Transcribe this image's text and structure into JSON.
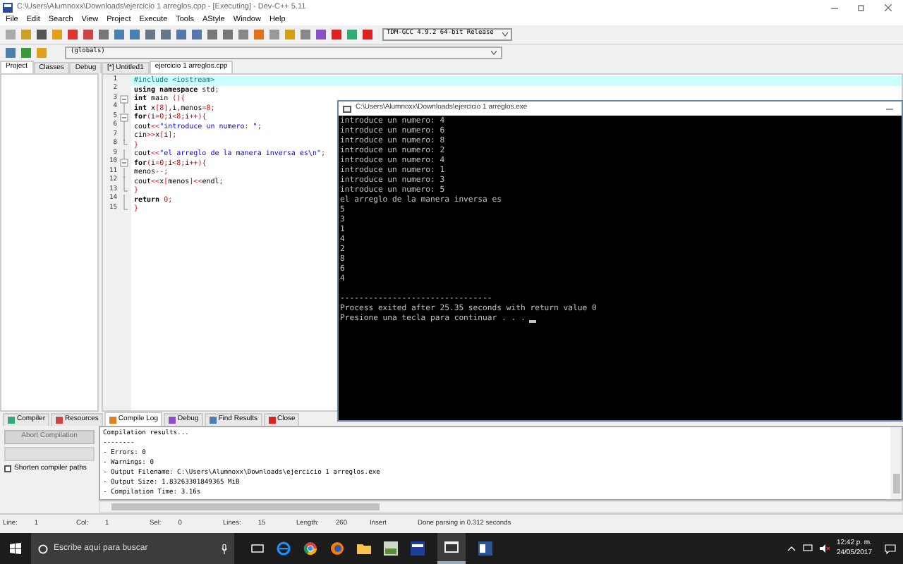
{
  "window": {
    "title": "C:\\Users\\Alumnoxx\\Downloads\\ejercicio 1 arreglos.cpp - [Executing] - Dev-C++ 5.11"
  },
  "menu": [
    "File",
    "Edit",
    "Search",
    "View",
    "Project",
    "Execute",
    "Tools",
    "AStyle",
    "Window",
    "Help"
  ],
  "compiler_select": {
    "value": "TDM-GCC 4.9.2 64-bit Release"
  },
  "scope_select": {
    "value": "(globals)"
  },
  "side_tabs": [
    {
      "label": "Project",
      "selected": true
    },
    {
      "label": "Classes",
      "selected": false
    },
    {
      "label": "Debug",
      "selected": false
    }
  ],
  "editor_tabs": [
    {
      "label": "[*] Untitled1",
      "selected": false
    },
    {
      "label": "ejercicio 1 arreglos.cpp",
      "selected": true
    }
  ],
  "code": [
    {
      "number": "1",
      "kind": "plain",
      "current": true,
      "tokens": [
        {
          "kind": "pre",
          "text": "#include <iostream>"
        }
      ]
    },
    {
      "number": "2",
      "kind": "plain",
      "current": false,
      "tokens": [
        {
          "kind": "kw",
          "text": "using namespace"
        },
        {
          "kind": "txt",
          "text": " std"
        },
        {
          "kind": "sym",
          "text": ";"
        }
      ]
    },
    {
      "number": "3",
      "kind": "open",
      "current": false,
      "tokens": [
        {
          "kind": "kw",
          "text": "int"
        },
        {
          "kind": "txt",
          "text": " main "
        },
        {
          "kind": "sym",
          "text": "(){"
        }
      ]
    },
    {
      "number": "4",
      "kind": "body",
      "current": false,
      "tokens": [
        {
          "kind": "kw",
          "text": "int"
        },
        {
          "kind": "txt",
          "text": " x"
        },
        {
          "kind": "sym",
          "text": "["
        },
        {
          "kind": "num",
          "text": "8"
        },
        {
          "kind": "sym",
          "text": "],"
        },
        {
          "kind": "txt",
          "text": "i"
        },
        {
          "kind": "sym",
          "text": ","
        },
        {
          "kind": "txt",
          "text": "menos"
        },
        {
          "kind": "sym",
          "text": "="
        },
        {
          "kind": "num",
          "text": "8"
        },
        {
          "kind": "sym",
          "text": ";"
        }
      ]
    },
    {
      "number": "5",
      "kind": "open",
      "current": false,
      "tokens": [
        {
          "kind": "kw",
          "text": "for"
        },
        {
          "kind": "sym",
          "text": "("
        },
        {
          "kind": "txt",
          "text": "i"
        },
        {
          "kind": "sym",
          "text": "="
        },
        {
          "kind": "num",
          "text": "0"
        },
        {
          "kind": "sym",
          "text": ";"
        },
        {
          "kind": "txt",
          "text": "i"
        },
        {
          "kind": "sym",
          "text": "<"
        },
        {
          "kind": "num",
          "text": "8"
        },
        {
          "kind": "sym",
          "text": ";"
        },
        {
          "kind": "txt",
          "text": "i"
        },
        {
          "kind": "sym",
          "text": "++){"
        }
      ]
    },
    {
      "number": "6",
      "kind": "body",
      "current": false,
      "tokens": [
        {
          "kind": "txt",
          "text": "cout"
        },
        {
          "kind": "sym",
          "text": "<<"
        },
        {
          "kind": "str",
          "text": "\"introduce un numero: \""
        },
        {
          "kind": "sym",
          "text": ";"
        }
      ]
    },
    {
      "number": "7",
      "kind": "body",
      "current": false,
      "tokens": [
        {
          "kind": "txt",
          "text": "cin"
        },
        {
          "kind": "sym",
          "text": ">>"
        },
        {
          "kind": "txt",
          "text": "x"
        },
        {
          "kind": "sym",
          "text": "["
        },
        {
          "kind": "txt",
          "text": "i"
        },
        {
          "kind": "sym",
          "text": "];"
        }
      ]
    },
    {
      "number": "8",
      "kind": "close",
      "current": false,
      "tokens": [
        {
          "kind": "sym",
          "text": "}"
        }
      ]
    },
    {
      "number": "9",
      "kind": "body",
      "current": false,
      "tokens": [
        {
          "kind": "txt",
          "text": "cout"
        },
        {
          "kind": "sym",
          "text": "<<"
        },
        {
          "kind": "str",
          "text": "\"el arreglo de la manera inversa es\\n\""
        },
        {
          "kind": "sym",
          "text": ";"
        }
      ]
    },
    {
      "number": "10",
      "kind": "open",
      "current": false,
      "tokens": [
        {
          "kind": "kw",
          "text": "for"
        },
        {
          "kind": "sym",
          "text": "("
        },
        {
          "kind": "txt",
          "text": "i"
        },
        {
          "kind": "sym",
          "text": "="
        },
        {
          "kind": "num",
          "text": "0"
        },
        {
          "kind": "sym",
          "text": ";"
        },
        {
          "kind": "txt",
          "text": "i"
        },
        {
          "kind": "sym",
          "text": "<"
        },
        {
          "kind": "num",
          "text": "8"
        },
        {
          "kind": "sym",
          "text": ";"
        },
        {
          "kind": "txt",
          "text": "i"
        },
        {
          "kind": "sym",
          "text": "++){"
        }
      ]
    },
    {
      "number": "11",
      "kind": "body",
      "current": false,
      "tokens": [
        {
          "kind": "txt",
          "text": "menos"
        },
        {
          "kind": "sym",
          "text": "--;"
        }
      ]
    },
    {
      "number": "12",
      "kind": "body",
      "current": false,
      "tokens": [
        {
          "kind": "txt",
          "text": "cout"
        },
        {
          "kind": "sym",
          "text": "<<"
        },
        {
          "kind": "txt",
          "text": "x"
        },
        {
          "kind": "sym",
          "text": "["
        },
        {
          "kind": "txt",
          "text": "menos"
        },
        {
          "kind": "sym",
          "text": "]<<"
        },
        {
          "kind": "txt",
          "text": "endl"
        },
        {
          "kind": "sym",
          "text": ";"
        }
      ]
    },
    {
      "number": "13",
      "kind": "close",
      "current": false,
      "tokens": [
        {
          "kind": "sym",
          "text": "}"
        }
      ]
    },
    {
      "number": "14",
      "kind": "body",
      "current": false,
      "tokens": [
        {
          "kind": "kw",
          "text": "return"
        },
        {
          "kind": "num",
          "text": " 0"
        },
        {
          "kind": "sym",
          "text": ";"
        }
      ]
    },
    {
      "number": "15",
      "kind": "close",
      "current": false,
      "tokens": [
        {
          "kind": "sym",
          "text": "}"
        }
      ]
    }
  ],
  "console": {
    "title": "C:\\Users\\Alumnoxx\\Downloads\\ejercicio 1 arreglos.exe",
    "lines": [
      "introduce un numero: 4",
      "introduce un numero: 6",
      "introduce un numero: 8",
      "introduce un numero: 2",
      "introduce un numero: 4",
      "introduce un numero: 1",
      "introduce un numero: 3",
      "introduce un numero: 5",
      "el arreglo de la manera inversa es",
      "5",
      "3",
      "1",
      "4",
      "2",
      "8",
      "6",
      "4"
    ],
    "footer": [
      "--------------------------------",
      "Process exited after 25.35 seconds with return value 0",
      "Presione una tecla para continuar . . ."
    ]
  },
  "bottom_tabs": [
    {
      "label": "Compiler",
      "selected": false
    },
    {
      "label": "Resources",
      "selected": false
    },
    {
      "label": "Compile Log",
      "selected": true
    },
    {
      "label": "Debug",
      "selected": false
    },
    {
      "label": "Find Results",
      "selected": false
    },
    {
      "label": "Close",
      "selected": false
    }
  ],
  "abort_button": {
    "label": "Abort Compilation",
    "disabled": true
  },
  "compile_progress": {
    "level": 0
  },
  "shorten_paths": {
    "label": "Shorten compiler paths",
    "checked": false
  },
  "compile_log": [
    "Compilation results...",
    "--------",
    "- Errors: 0",
    "- Warnings: 0",
    "- Output Filename: C:\\Users\\Alumnoxx\\Downloads\\ejercicio 1 arreglos.exe",
    "- Output Size: 1.83263301849365 MiB",
    "- Compilation Time: 3.16s"
  ],
  "status_bar": {
    "fields": [
      {
        "label": "Line:",
        "value": "1"
      },
      {
        "label": "Col:",
        "value": "1"
      },
      {
        "label": "Sel:",
        "value": "0"
      },
      {
        "label": "Lines:",
        "value": "15"
      },
      {
        "label": "Length:",
        "value": "260"
      }
    ],
    "mode": "Insert",
    "message": "Done parsing in 0.312 seconds"
  },
  "taskbar": {
    "search_placeholder": "Escribe aquí para buscar",
    "time": "12:42 p. m.",
    "date": "24/05/2017"
  }
}
